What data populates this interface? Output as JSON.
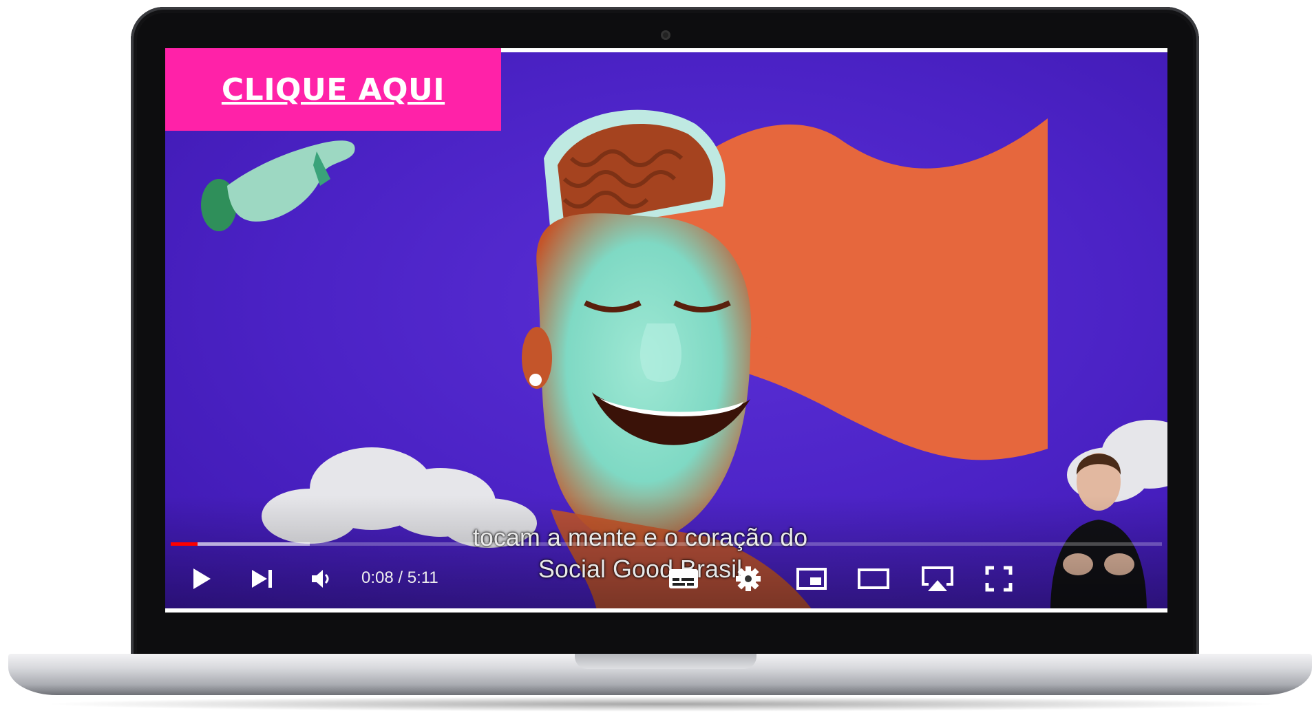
{
  "cta": {
    "label": "CLIQUE AQUI"
  },
  "subtitles": {
    "line1": "tocam a mente e o coração do",
    "line2": "Social Good Brasil"
  },
  "player": {
    "current_time": "0:08",
    "separator": " / ",
    "duration": "5:11",
    "progress_played_fraction": 0.027,
    "progress_buffered_fraction": 0.14,
    "progress_color": "#ff0000"
  },
  "colors": {
    "video_bg": "#4a21c4",
    "cta_bg": "#ff22a8",
    "flag": "#e6673d",
    "face_cyan": "#7fd9c4",
    "face_orange": "#c4552a"
  },
  "icons": [
    "play-icon",
    "next-icon",
    "volume-icon",
    "subtitles-icon",
    "settings-icon",
    "miniplayer-icon",
    "theater-mode-icon",
    "airplay-icon",
    "fullscreen-icon"
  ]
}
